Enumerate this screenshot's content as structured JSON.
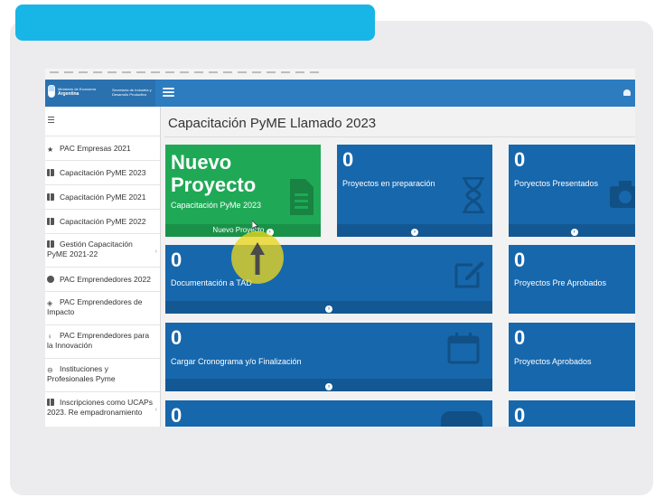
{
  "header": {
    "logo_line1": "Ministerio de Economía",
    "logo_line2": "Argentina",
    "logo_right": "Secretaría de Industria y Desarrollo Productivo"
  },
  "page": {
    "title": "Capacitación PyME Llamado 2023"
  },
  "sidebar": {
    "items": [
      {
        "label": "PAC Empresas 2021",
        "icon": "star-icon"
      },
      {
        "label": "Capacitación PyME 2023",
        "icon": "book-icon"
      },
      {
        "label": "Capacitación PyME 2021",
        "icon": "book-icon"
      },
      {
        "label": "Capacitación PyME 2022",
        "icon": "book-icon"
      },
      {
        "label": "Gestión Capacitación PyME 2021-22",
        "icon": "book-icon"
      },
      {
        "label": "PAC Emprendedores 2022",
        "icon": "check-circle-icon"
      },
      {
        "label": "PAC Emprendedores de Impacto",
        "icon": "eye-icon"
      },
      {
        "label": "PAC Emprendedores para la Innovación",
        "icon": "lightbulb-icon"
      },
      {
        "label": "Instituciones y Profesionales Pyme",
        "icon": "link-icon"
      },
      {
        "label": "Inscripciones como UCAPs 2023. Re empadronamiento",
        "icon": "book-icon"
      }
    ]
  },
  "tiles": {
    "nuevo": {
      "title": "Nuevo Proyecto",
      "subtitle": "Capacitación PyMe 2023",
      "footer": "Nuevo Proyecto"
    },
    "preparacion": {
      "count": "0",
      "label": "Proyectos en preparación"
    },
    "presentados": {
      "count": "0",
      "label": "Poryectos Presentados"
    },
    "documentacion": {
      "count": "0",
      "label": "Documentación a TAD"
    },
    "pre_aprobados": {
      "count": "0",
      "label": "Proyectos Pre Aprobados"
    },
    "cronograma": {
      "count": "0",
      "label": "Cargar Cronograma y/o Finalización"
    },
    "aprobados": {
      "count": "0",
      "label": "Proyectos Aprobados"
    },
    "row4_left": {
      "count": "0"
    },
    "row4_right": {
      "count": "0"
    }
  },
  "colors": {
    "tile_blue": "#1767ac",
    "tile_green": "#1fa956",
    "topbar": "#2d7cc0",
    "accent_cyan": "#17b6e6",
    "highlight_yellow": "#e8d61e"
  }
}
